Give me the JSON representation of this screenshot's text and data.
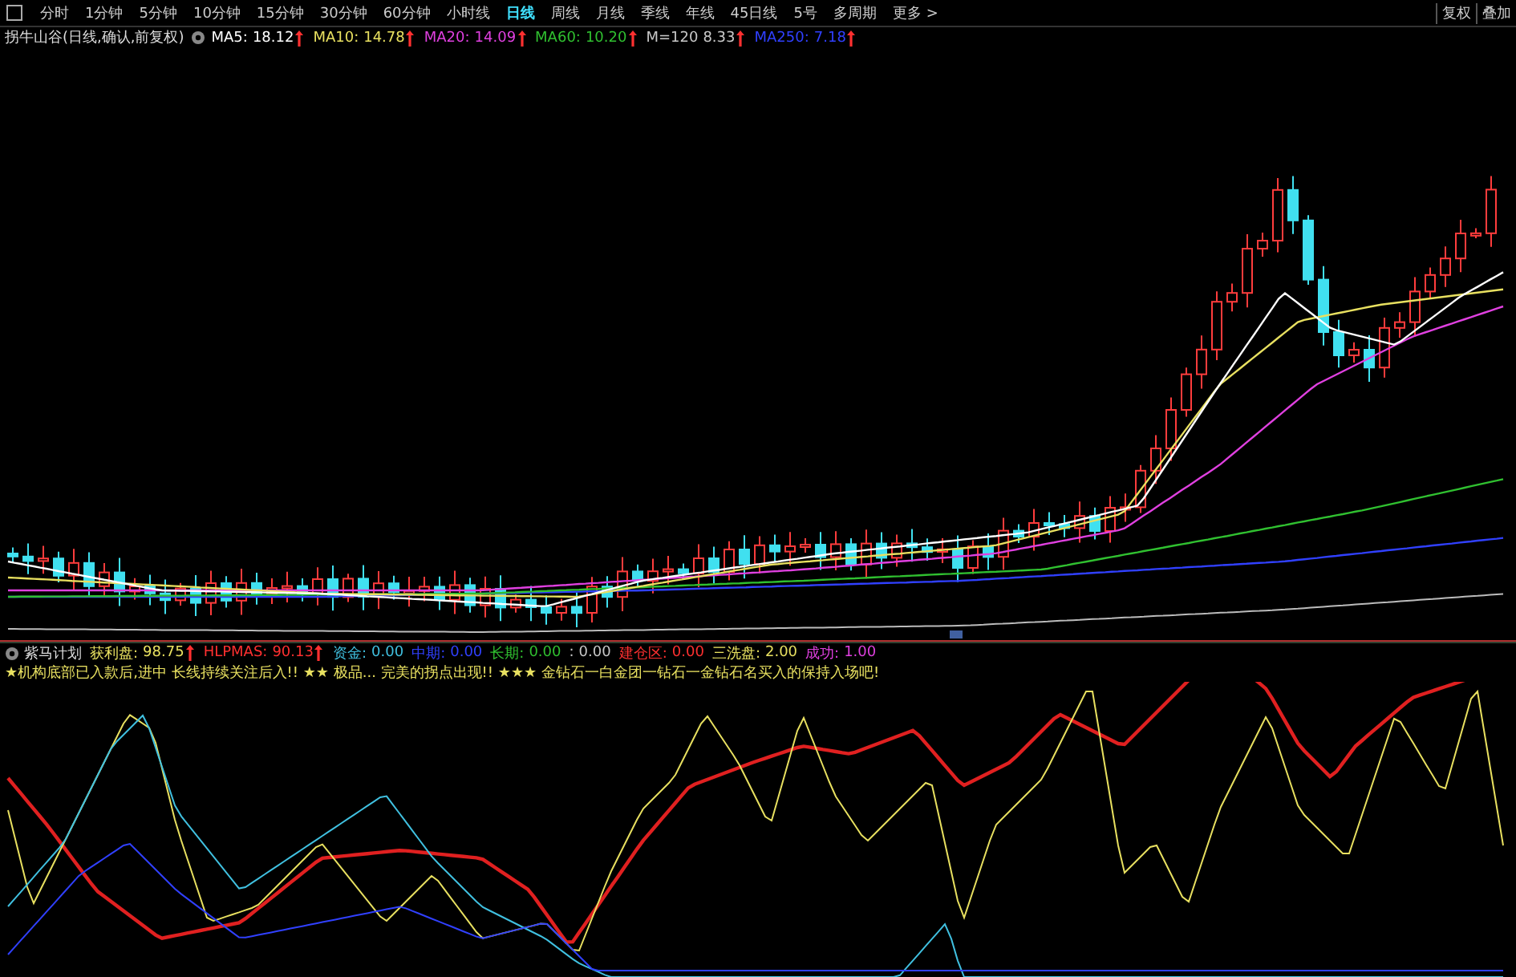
{
  "period_tabs": [
    {
      "label": "分时",
      "selected": false
    },
    {
      "label": "1分钟",
      "selected": false
    },
    {
      "label": "5分钟",
      "selected": false
    },
    {
      "label": "10分钟",
      "selected": false
    },
    {
      "label": "15分钟",
      "selected": false
    },
    {
      "label": "30分钟",
      "selected": false
    },
    {
      "label": "60分钟",
      "selected": false
    },
    {
      "label": "小时线",
      "selected": false
    },
    {
      "label": "日线",
      "selected": true
    },
    {
      "label": "周线",
      "selected": false
    },
    {
      "label": "月线",
      "selected": false
    },
    {
      "label": "季线",
      "selected": false
    },
    {
      "label": "年线",
      "selected": false
    },
    {
      "label": "45日线",
      "selected": false
    },
    {
      "label": "5号",
      "selected": false
    },
    {
      "label": "多周期",
      "selected": false
    },
    {
      "label": "更多 >",
      "selected": false
    }
  ],
  "toolbar_right": [
    {
      "label": "复权"
    },
    {
      "label": "叠加"
    }
  ],
  "main_chart": {
    "title": "拐牛山谷(日线,确认,前复权)",
    "indicators": [
      {
        "name": "MA5:",
        "value": "18.12",
        "color": "#ffffff"
      },
      {
        "name": "MA10:",
        "value": "14.78",
        "color": "#e8e060"
      },
      {
        "name": "MA20:",
        "value": "14.09",
        "color": "#e040e0"
      },
      {
        "name": "MA60:",
        "value": "10.20",
        "color": "#30c030"
      },
      {
        "name": "M=120",
        "value": "8.33",
        "color": "#c8c8c8"
      },
      {
        "name": "MA250:",
        "value": "7.18",
        "color": "#3040ff"
      }
    ]
  },
  "sub_chart": {
    "title": "紫马计划",
    "indicators": [
      {
        "name": "获利盘:",
        "value": "98.75",
        "color": "#e8e060",
        "arrow": true
      },
      {
        "name": "HLPMAS:",
        "value": "90.13",
        "color": "#ff3030",
        "arrow": true
      },
      {
        "name": "资金:",
        "value": "0.00",
        "color": "#40c0e0",
        "arrow": false
      },
      {
        "name": "中期:",
        "value": "0.00",
        "color": "#3040ff",
        "arrow": false
      },
      {
        "name": "长期:",
        "value": "0.00",
        "color": "#30c030",
        "arrow": false
      },
      {
        "name": ":",
        "value": "0.00",
        "color": "#c8c8c8",
        "arrow": false
      },
      {
        "name": "建仓区:",
        "value": "0.00",
        "color": "#ff3030",
        "arrow": false
      },
      {
        "name": "三洗盘:",
        "value": "2.00",
        "color": "#e8e060",
        "arrow": false
      },
      {
        "name": "成功:",
        "value": "1.00",
        "color": "#e040e0",
        "arrow": false
      }
    ],
    "notice": "★机构底部已入款后,进中 长线持续关注后入!! ★★ 极品... 完美的拐点出现!! ★★★ 金钻石一白金团一钻石一金钻石名买入的保持入场吧!"
  }
}
